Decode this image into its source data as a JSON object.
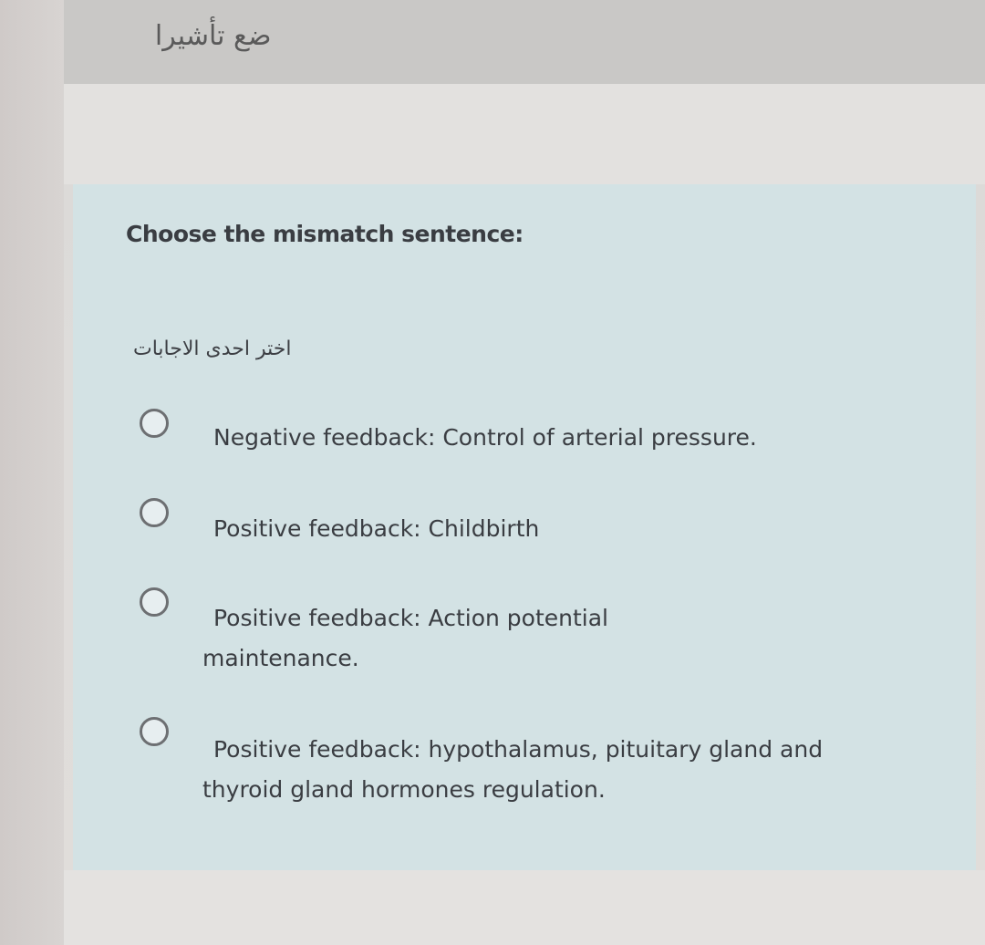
{
  "header": {
    "flag_label": "ضع تأشيرا"
  },
  "question": {
    "text": "Choose the mismatch sentence:",
    "instruction": "اختر احدى الاجابات"
  },
  "options": [
    {
      "label": "Negative feedback: Control of arterial pressure.",
      "selected": false
    },
    {
      "label": "Positive feedback: Childbirth",
      "selected": false
    },
    {
      "label": "Positive feedback: Action potential maintenance.",
      "selected": false
    },
    {
      "label": "Positive feedback: hypothalamus, pituitary gland and thyroid gland hormones regulation.",
      "selected": false
    }
  ],
  "colors": {
    "card_background": "#d3e2e4",
    "text": "#3a3d42",
    "radio_border": "#6d6f72"
  }
}
